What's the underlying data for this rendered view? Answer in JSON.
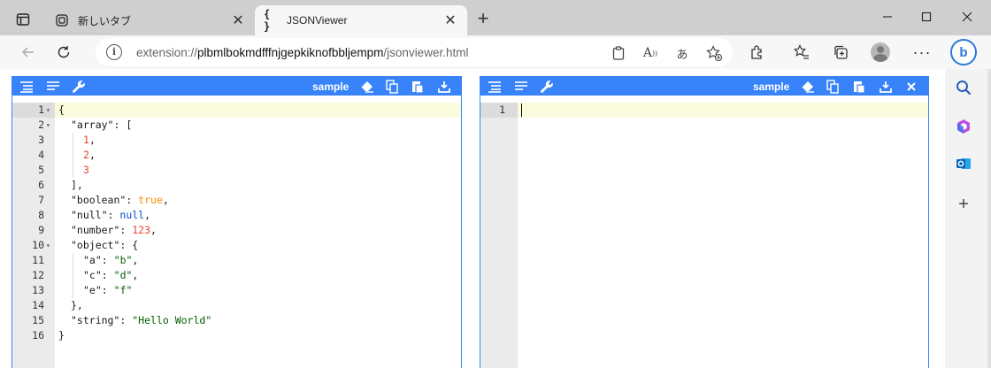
{
  "tabs": [
    {
      "title": "新しいタブ",
      "favicon": "new-tab-page-icon"
    },
    {
      "title": "JSONViewer",
      "favicon": "{ }"
    }
  ],
  "address": {
    "scheme": "extension://",
    "host": "plbmlbokmdfffnjgepkiknofbbljempm",
    "path": "/jsonviewer.html"
  },
  "editor": {
    "menu_sample": "sample",
    "left_lines": [
      {
        "n": "1",
        "fold": true,
        "indent": 0,
        "tokens": [
          [
            "p",
            "{"
          ]
        ]
      },
      {
        "n": "2",
        "fold": true,
        "indent": 1,
        "tokens": [
          [
            "k",
            "\"array\""
          ],
          [
            "p",
            ": ["
          ]
        ]
      },
      {
        "n": "3",
        "fold": false,
        "indent": 2,
        "tokens": [
          [
            "n",
            "1"
          ],
          [
            "p",
            ","
          ]
        ]
      },
      {
        "n": "4",
        "fold": false,
        "indent": 2,
        "tokens": [
          [
            "n",
            "2"
          ],
          [
            "p",
            ","
          ]
        ]
      },
      {
        "n": "5",
        "fold": false,
        "indent": 2,
        "tokens": [
          [
            "n",
            "3"
          ]
        ]
      },
      {
        "n": "6",
        "fold": false,
        "indent": 1,
        "tokens": [
          [
            "p",
            "],"
          ]
        ]
      },
      {
        "n": "7",
        "fold": false,
        "indent": 1,
        "tokens": [
          [
            "k",
            "\"boolean\""
          ],
          [
            "p",
            ": "
          ],
          [
            "b",
            "true"
          ],
          [
            "p",
            ","
          ]
        ]
      },
      {
        "n": "8",
        "fold": false,
        "indent": 1,
        "tokens": [
          [
            "k",
            "\"null\""
          ],
          [
            "p",
            ": "
          ],
          [
            "u",
            "null"
          ],
          [
            "p",
            ","
          ]
        ]
      },
      {
        "n": "9",
        "fold": false,
        "indent": 1,
        "tokens": [
          [
            "k",
            "\"number\""
          ],
          [
            "p",
            ": "
          ],
          [
            "n",
            "123"
          ],
          [
            "p",
            ","
          ]
        ]
      },
      {
        "n": "10",
        "fold": true,
        "indent": 1,
        "tokens": [
          [
            "k",
            "\"object\""
          ],
          [
            "p",
            ": {"
          ]
        ]
      },
      {
        "n": "11",
        "fold": false,
        "indent": 2,
        "tokens": [
          [
            "k",
            "\"a\""
          ],
          [
            "p",
            ": "
          ],
          [
            "s",
            "\"b\""
          ],
          [
            "p",
            ","
          ]
        ]
      },
      {
        "n": "12",
        "fold": false,
        "indent": 2,
        "tokens": [
          [
            "k",
            "\"c\""
          ],
          [
            "p",
            ": "
          ],
          [
            "s",
            "\"d\""
          ],
          [
            "p",
            ","
          ]
        ]
      },
      {
        "n": "13",
        "fold": false,
        "indent": 2,
        "tokens": [
          [
            "k",
            "\"e\""
          ],
          [
            "p",
            ": "
          ],
          [
            "s",
            "\"f\""
          ]
        ]
      },
      {
        "n": "14",
        "fold": false,
        "indent": 1,
        "tokens": [
          [
            "p",
            "},"
          ]
        ]
      },
      {
        "n": "15",
        "fold": false,
        "indent": 1,
        "tokens": [
          [
            "k",
            "\"string\""
          ],
          [
            "p",
            ": "
          ],
          [
            "s",
            "\"Hello World\""
          ]
        ]
      },
      {
        "n": "16",
        "fold": false,
        "indent": 0,
        "tokens": [
          [
            "p",
            "}"
          ]
        ]
      }
    ],
    "right_lines": [
      {
        "n": "1"
      }
    ]
  },
  "colors": {
    "menu_blue": "#3883fa",
    "string": "#006000",
    "number": "#ee422e",
    "boolean": "#ff8c00",
    "null": "#004ed0"
  }
}
